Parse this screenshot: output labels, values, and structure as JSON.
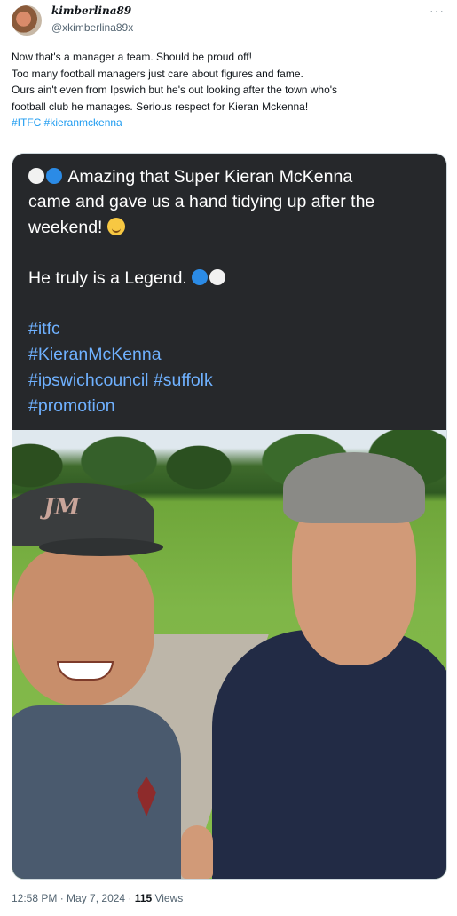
{
  "author": {
    "display_name": "kimberlina89",
    "handle": "@xkimberlina89x"
  },
  "more_icon": "more-dots-icon",
  "tweet": {
    "lines": [
      "Now that's a manager a team. Should be proud off!",
      "Too many football managers just care about figures and fame.",
      "Ours ain't even from Ipswich but he's out looking after the town who's",
      "football club he manages. Serious respect for Kieran Mckenna!"
    ],
    "hashtags": "#ITFC #kieranmckenna"
  },
  "media_caption": {
    "line1": "Amazing that Super Kieran McKenna",
    "line2": "came and gave us a hand tidying up after the",
    "line3": "weekend!",
    "line4": "He truly is a Legend.",
    "tags": [
      "#itfc",
      "#KieranMcKenna",
      "#ipswichcouncil #suffolk",
      "#promotion"
    ]
  },
  "photo": {
    "cap_logo": "JM"
  },
  "footer": {
    "time": "12:58 PM",
    "sep1": " · ",
    "date": "May 7, 2024",
    "sep2": " · ",
    "views_count": "115",
    "views_label": " Views"
  },
  "colors": {
    "link": "#1d9bf0",
    "caption_bg": "#26282b",
    "caption_tag": "#6fb1ff"
  }
}
